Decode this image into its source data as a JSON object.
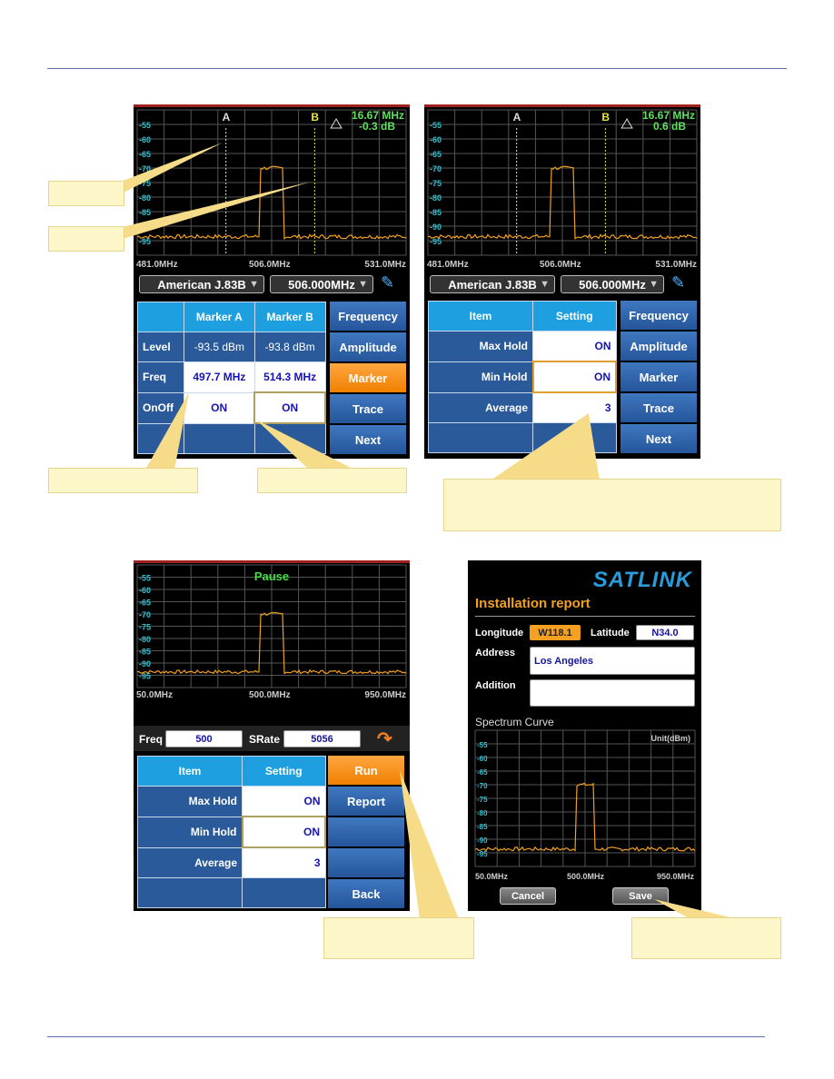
{
  "colors": {
    "trace": "#f0a020",
    "axis_label": "#30c0d0",
    "grid": "#555555",
    "header_cell": "#1ea0e0",
    "button": "#2f66ad",
    "active_button": "#f58a10",
    "marker_a": "#dddddd",
    "marker_b": "#e6e640",
    "delta": "#60e060",
    "brand": "#2a9ad8",
    "report_title": "#f0a020"
  },
  "y_ticks": [
    "-55",
    "-60",
    "-65",
    "-70",
    "-75",
    "-80",
    "-85",
    "-90",
    "-95"
  ],
  "panel1": {
    "marker_a_label": "A",
    "marker_b_label": "B",
    "delta_icon": "triangle-icon",
    "delta_freq": "16.67 MHz",
    "delta_level": "-0.3 dB",
    "x_labels": [
      "481.0MHz",
      "506.0MHz",
      "531.0MHz"
    ],
    "standard": "American J.83B",
    "frequency": "506.000MHz",
    "table": {
      "headers": [
        "",
        "Marker A",
        "Marker B"
      ],
      "rows": [
        [
          "Level",
          "-93.5 dBm",
          "-93.8 dBm"
        ],
        [
          "Freq",
          "497.7 MHz",
          "514.3 MHz"
        ],
        [
          "OnOff",
          "ON",
          "ON"
        ],
        [
          "",
          "",
          ""
        ]
      ]
    },
    "buttons": [
      "Frequency",
      "Amplitude",
      "Marker",
      "Trace",
      "Next"
    ],
    "active": "Marker"
  },
  "panel2": {
    "marker_a_label": "A",
    "marker_b_label": "B",
    "delta_icon": "triangle-icon",
    "delta_freq": "16.67 MHz",
    "delta_level": "0.6 dB",
    "x_labels": [
      "481.0MHz",
      "506.0MHz",
      "531.0MHz"
    ],
    "standard": "American J.83B",
    "frequency": "506.000MHz",
    "table": {
      "headers": [
        "Item",
        "Setting"
      ],
      "rows": [
        [
          "Max Hold",
          "ON"
        ],
        [
          "Min Hold",
          "ON"
        ],
        [
          "Average",
          "3"
        ],
        [
          "",
          ""
        ]
      ]
    },
    "buttons": [
      "Frequency",
      "Amplitude",
      "Marker",
      "Trace",
      "Next"
    ]
  },
  "panel3": {
    "status": "Pause",
    "x_labels": [
      "50.0MHz",
      "500.0MHz",
      "950.0MHz"
    ],
    "freq_label": "Freq",
    "freq_value": "500",
    "srate_label": "SRate",
    "srate_value": "5056",
    "action_icon": "redo-arrow-icon",
    "table": {
      "headers": [
        "Item",
        "Setting"
      ],
      "rows": [
        [
          "Max Hold",
          "ON"
        ],
        [
          "Min Hold",
          "ON"
        ],
        [
          "Average",
          "3"
        ],
        [
          "",
          ""
        ]
      ]
    },
    "buttons": [
      "Run",
      "Report",
      "",
      "",
      "Back"
    ],
    "active": "Run"
  },
  "panel4": {
    "brand": "SATLINK",
    "title": "Installation report",
    "longitude_label": "Longitude",
    "longitude": "W118.1",
    "latitude_label": "Latitude",
    "latitude": "N34.0",
    "address_label": "Address",
    "address": "Los Angeles",
    "addition_label": "Addition",
    "addition": "",
    "spectrum_title": "Spectrum Curve",
    "unit": "Unit(dBm)",
    "x_labels": [
      "50.0MHz",
      "500.0MHz",
      "950.0MHz"
    ],
    "cancel": "Cancel",
    "save": "Save"
  }
}
